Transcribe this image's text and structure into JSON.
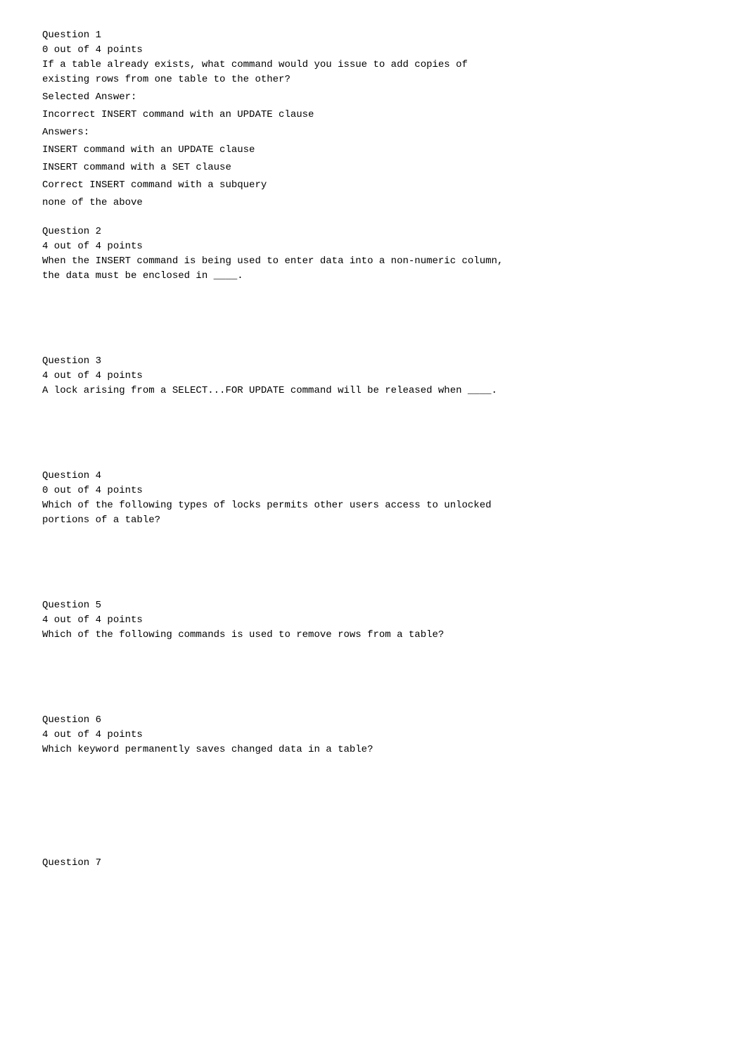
{
  "questions": [
    {
      "id": "question-1",
      "title": "Question 1",
      "points": "0 out of 4 points",
      "text": "If a table already exists, what command would you issue to add copies of\nexisting rows from one table to the other?",
      "selected_answer_label": "Selected Answer:",
      "selected_answer": "Incorrect INSERT command with an UPDATE clause",
      "answers_label": "Answers:",
      "answers": [
        "INSERT command with an UPDATE clause",
        "INSERT command with a SET clause",
        "Correct INSERT command with a subquery",
        "none of the above"
      ],
      "has_answers": true
    },
    {
      "id": "question-2",
      "title": "Question 2",
      "points": "4 out of 4 points",
      "text": "When the INSERT command is being used to enter data into a non-numeric column,\nthe data must be enclosed in ____.",
      "has_answers": false
    },
    {
      "id": "question-3",
      "title": "Question 3",
      "points": "4 out of 4 points",
      "text": "A lock arising from a SELECT...FOR UPDATE command will be released when ____.",
      "has_answers": false
    },
    {
      "id": "question-4",
      "title": "Question 4",
      "points": "0 out of 4 points",
      "text": "Which of the following types of locks permits other users access to unlocked\nportions of a table?",
      "has_answers": false
    },
    {
      "id": "question-5",
      "title": "Question 5",
      "points": "4 out of 4 points",
      "text": "Which of the following commands is used to remove rows from a table?",
      "has_answers": false
    },
    {
      "id": "question-6",
      "title": "Question 6",
      "points": "4 out of 4 points",
      "text": "Which keyword permanently saves changed data in a table?",
      "has_answers": false
    },
    {
      "id": "question-7",
      "title": "Question 7",
      "points": "",
      "text": "",
      "has_answers": false
    }
  ]
}
